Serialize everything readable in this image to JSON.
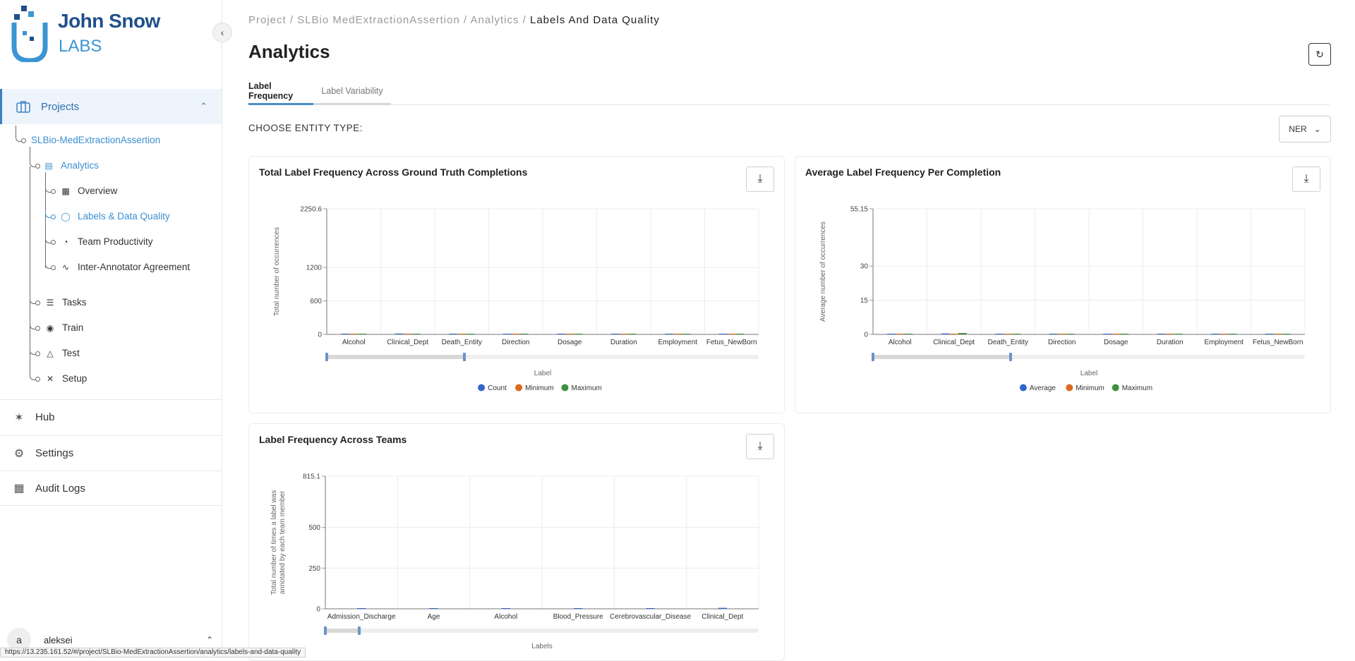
{
  "app": {
    "logo_line1": "John Snow",
    "logo_line2": "LABS"
  },
  "sidebar": {
    "projects_label": "Projects",
    "project_name": "SLBio-MedExtractionAssertion",
    "analytics_label": "Analytics",
    "analytics_items": [
      {
        "label": "Overview",
        "icon": "bar-chart-icon"
      },
      {
        "label": "Labels & Data Quality",
        "icon": "bulb-icon"
      },
      {
        "label": "Team Productivity",
        "icon": "gauge-icon"
      },
      {
        "label": "Inter-Annotator Agreement",
        "icon": "handshake-icon"
      }
    ],
    "project_items": [
      {
        "label": "Tasks",
        "icon": "checklist-icon"
      },
      {
        "label": "Train",
        "icon": "brain-icon"
      },
      {
        "label": "Test",
        "icon": "flask-icon"
      },
      {
        "label": "Setup",
        "icon": "tools-icon"
      }
    ],
    "main_items": [
      {
        "label": "Hub",
        "icon": "hub-icon"
      },
      {
        "label": "Settings",
        "icon": "gear-icon"
      },
      {
        "label": "Audit Logs",
        "icon": "grid-icon"
      }
    ],
    "user_initial": "a",
    "user_name": "aleksei"
  },
  "status_url": "https://13.235.161.52/#/project/SLBio-MedExtractionAssertion/analytics/labels-and-data-quality",
  "breadcrumb": {
    "parts": "Project / SLBio MedExtractionAssertion / Analytics /",
    "current": " Labels And Data Quality"
  },
  "page_title": "Analytics",
  "tabs": [
    "Label Frequency",
    "Label Variability"
  ],
  "choose_entity_label": "CHOOSE ENTITY TYPE:",
  "entity_type_value": "NER",
  "colors": {
    "accent": "#4a90c8",
    "series_blue": "#3366cc",
    "series_orange": "#dc6a1c",
    "series_green": "#3f8f3f"
  },
  "chart_data": [
    {
      "type": "bar",
      "title": "Total Label Frequency Across Ground Truth Completions",
      "xlabel": "Label",
      "ylabel": "Total number of occurrences",
      "yticks": [
        "2250.6",
        "1200",
        "600",
        "0"
      ],
      "ytick_values": [
        2250.6,
        1200,
        600,
        0
      ],
      "ylim": [
        0,
        2250.6
      ],
      "categories": [
        "Alcohol",
        "Clinical_Dept",
        "Death_Entity",
        "Direction",
        "Dosage",
        "Duration",
        "Employment",
        "Fetus_NewBorn"
      ],
      "series": [
        {
          "name": "Count",
          "values": [
            2,
            15,
            3,
            8,
            6,
            2,
            4,
            3
          ]
        },
        {
          "name": "Minimum",
          "values": [
            0,
            0,
            0,
            0,
            0,
            0,
            0,
            0
          ]
        },
        {
          "name": "Maximum",
          "values": [
            1,
            6,
            1,
            3,
            2,
            1,
            2,
            1
          ]
        }
      ],
      "legend_position": "bottom"
    },
    {
      "type": "bar",
      "title": "Average Label Frequency Per Completion",
      "xlabel": "Label",
      "ylabel": "Average number of occurrences",
      "yticks": [
        "55.15",
        "30",
        "15",
        "0"
      ],
      "ytick_values": [
        55.15,
        30,
        15,
        0
      ],
      "ylim": [
        0,
        55.15
      ],
      "categories": [
        "Alcohol",
        "Clinical_Dept",
        "Death_Entity",
        "Direction",
        "Dosage",
        "Duration",
        "Employment",
        "Fetus_NewBorn"
      ],
      "series": [
        {
          "name": "Average",
          "values": [
            0.1,
            0.4,
            0.1,
            0.2,
            0.2,
            0.1,
            0.1,
            0.1
          ]
        },
        {
          "name": "Minimum",
          "values": [
            0,
            0,
            0,
            0,
            0,
            0,
            0,
            0
          ]
        },
        {
          "name": "Maximum",
          "values": [
            0.2,
            0.6,
            0.2,
            0.3,
            0.3,
            0.2,
            0.2,
            0.2
          ]
        }
      ],
      "legend_position": "bottom"
    },
    {
      "type": "bar",
      "title": "Label Frequency Across Teams",
      "xlabel": "Labels",
      "ylabel_lines": [
        "Total number of times a label was",
        "annotated by each team member"
      ],
      "yticks": [
        "815.1",
        "500",
        "250",
        "0"
      ],
      "ytick_values": [
        815.1,
        500,
        250,
        0
      ],
      "ylim": [
        0,
        815.1
      ],
      "categories": [
        "Admission_Discharge",
        "Age",
        "Alcohol",
        "Blood_Pressure",
        "Cerebrovascular_Disease",
        "Clinical_Dept"
      ],
      "series": [
        {
          "values": [
            3,
            2,
            1,
            2,
            1,
            6
          ]
        }
      ],
      "legend_position": "none"
    }
  ]
}
